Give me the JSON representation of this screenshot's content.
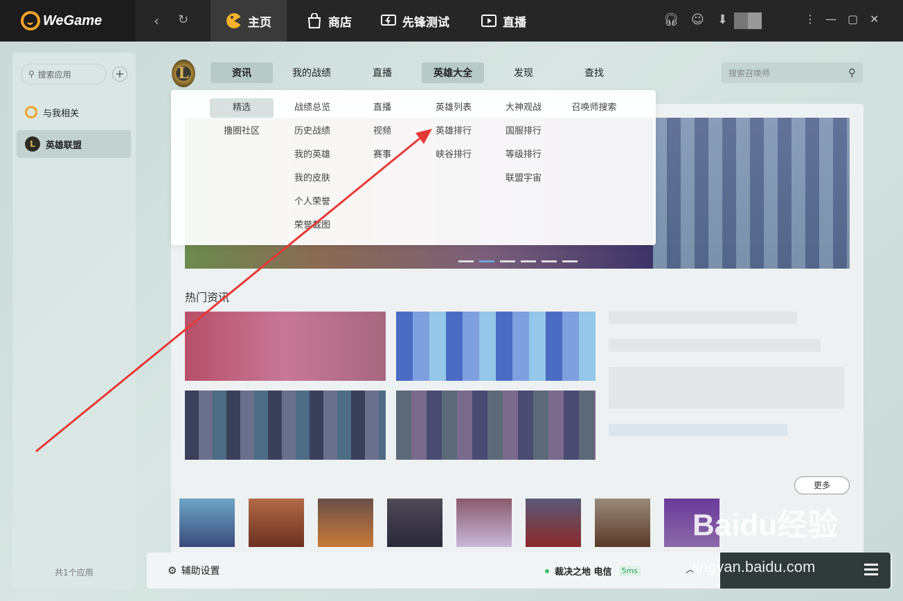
{
  "titlebar": {
    "brand": "WeGame",
    "tabs": [
      {
        "label": "主页",
        "icon": "pacman-icon",
        "active": true
      },
      {
        "label": "商店",
        "icon": "bag-icon",
        "active": false
      },
      {
        "label": "先锋测试",
        "icon": "lightning-monitor-icon",
        "active": false
      },
      {
        "label": "直播",
        "icon": "play-icon",
        "active": false
      }
    ]
  },
  "sidebar": {
    "search_placeholder": "搜索应用",
    "items": [
      {
        "label": "与我相关",
        "icon": "wegame-related-icon",
        "active": false
      },
      {
        "label": "英雄联盟",
        "icon": "lol-icon",
        "active": true
      }
    ],
    "footer": "共1个应用"
  },
  "game_nav": {
    "tabs": [
      {
        "label": "资讯",
        "active": true
      },
      {
        "label": "我的战绩",
        "active": false
      },
      {
        "label": "直播",
        "active": false
      },
      {
        "label": "英雄大全",
        "active": true
      },
      {
        "label": "发现",
        "active": false
      },
      {
        "label": "查找",
        "active": false
      }
    ],
    "search_placeholder": "搜索召唤师"
  },
  "dropdown": {
    "col1": [
      "精选",
      "撸圈社区"
    ],
    "col2": [
      "战绩总览",
      "历史战绩",
      "我的英雄",
      "我的皮肤",
      "个人荣誉",
      "荣誉截图"
    ],
    "col3": [
      "直播",
      "视频",
      "赛事"
    ],
    "col4": [
      "英雄列表",
      "英雄排行",
      "峡谷排行"
    ],
    "col5": [
      "大神观战",
      "国服排行",
      "等级排行",
      "联盟宇宙"
    ],
    "col6": [
      "召唤师搜索"
    ]
  },
  "content": {
    "section_title": "热门资讯",
    "more_label": "更多"
  },
  "bottom": {
    "assist_label": "辅助设置",
    "server": "裁决之地 电信",
    "ping": "5ms"
  },
  "watermark": {
    "main": "Baidu经验",
    "sub": "jingyan.baidu.com"
  },
  "colors": {
    "accent": "#f2a32a",
    "arrow": "#e53935",
    "status_green": "#3cc06a"
  }
}
